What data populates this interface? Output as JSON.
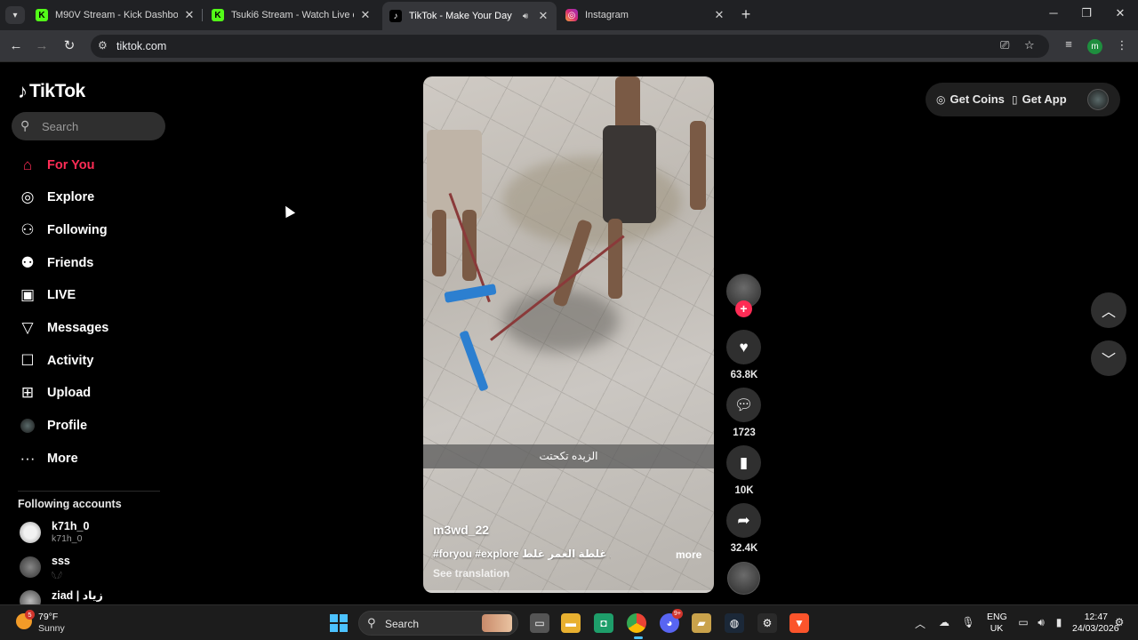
{
  "browser": {
    "tabs": [
      {
        "title": "M90V Stream - Kick Dashboard",
        "favicon": "kick-icon",
        "active": false
      },
      {
        "title": "Tsuki6 Stream - Watch Live on Kick",
        "favicon": "kick-icon",
        "active": false
      },
      {
        "title": "TikTok - Make Your Day",
        "favicon": "tiktok-icon",
        "active": true
      },
      {
        "title": "Instagram",
        "favicon": "instagram-icon",
        "active": false
      }
    ],
    "url": "tiktok.com",
    "profile_initial": "m"
  },
  "sidebar": {
    "logo": "TikTok",
    "search_placeholder": "Search",
    "nav": [
      {
        "label": "For You",
        "icon": "home-icon",
        "active": true
      },
      {
        "label": "Explore",
        "icon": "compass-icon"
      },
      {
        "label": "Following",
        "icon": "user-follow-icon"
      },
      {
        "label": "Friends",
        "icon": "friends-icon"
      },
      {
        "label": "LIVE",
        "icon": "live-icon"
      },
      {
        "label": "Messages",
        "icon": "send-icon"
      },
      {
        "label": "Activity",
        "icon": "inbox-icon"
      },
      {
        "label": "Upload",
        "icon": "plus-square-icon"
      },
      {
        "label": "Profile",
        "icon": "profile-avatar"
      },
      {
        "label": "More",
        "icon": "ellipsis-icon"
      }
    ],
    "following_title": "Following accounts",
    "following": [
      {
        "name": "k71h_0",
        "handle": "k71h_0"
      },
      {
        "name": "sss",
        "handle": "𓆩𓆪"
      },
      {
        "name": "ziad | زياد",
        "handle": ""
      }
    ]
  },
  "video": {
    "caption_overlay": "الزيده تكحتت",
    "username": "m3wd_22",
    "description": "#foryou #explore غلطة العمر غلط ...",
    "more_label": "more",
    "translation_label": "See translation"
  },
  "actions": {
    "likes": "63.8K",
    "comments": "1723",
    "saves": "10K",
    "shares": "32.4K"
  },
  "header_right": {
    "coins": "Get Coins",
    "app": "Get App"
  },
  "taskbar": {
    "temperature": "79°F",
    "weather": "Sunny",
    "weather_badge": "5",
    "search": "Search",
    "discord_badge": "9+",
    "lang_top": "ENG",
    "lang_bottom": "UK",
    "time": "12:47",
    "date": "24/03/2026"
  },
  "colors": {
    "accent": "#fe2c55",
    "background": "#000000"
  }
}
